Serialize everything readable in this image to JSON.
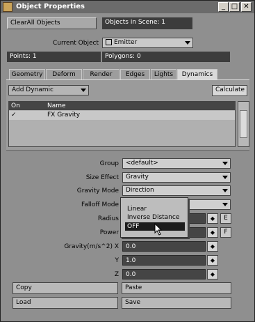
{
  "window": {
    "title": "Object Properties",
    "minimize_glyph": "_",
    "maximize_glyph": "□",
    "close_glyph": "✕"
  },
  "top": {
    "clear_all_label": "ClearAll Objects",
    "objects_in_scene": "Objects in Scene: 1",
    "current_object_label": "Current Object",
    "current_object_value": "Emitter",
    "points": "Points: 1",
    "polygons": "Polygons: 0"
  },
  "tabs": [
    {
      "label": "Geometry",
      "active": false
    },
    {
      "label": "Deform",
      "active": false
    },
    {
      "label": "Render",
      "active": false
    },
    {
      "label": "Edges",
      "active": false
    },
    {
      "label": "Lights",
      "active": false
    },
    {
      "label": "Dynamics",
      "active": true
    }
  ],
  "dynamics": {
    "add_dynamic_label": "Add Dynamic",
    "calculate_label": "Calculate",
    "list_headers": {
      "on": "On",
      "name": "Name"
    },
    "list_rows": [
      {
        "on": "✓",
        "name": "FX Gravity"
      }
    ]
  },
  "form": {
    "group": {
      "label": "Group",
      "value": "<default>"
    },
    "size_effect": {
      "label": "Size Effect",
      "value": "Gravity"
    },
    "gravity_mode": {
      "label": "Gravity Mode",
      "value": "Direction"
    },
    "falloff_mode": {
      "label": "Falloff Mode",
      "value": ""
    },
    "radius": {
      "label": "Radius",
      "env": "E"
    },
    "power": {
      "label": "Power",
      "env": "F"
    },
    "gravity_x": {
      "label": "Gravity(m/s^2) X",
      "value": "0.0"
    },
    "gravity_y": {
      "label": "Y",
      "value": "1.0"
    },
    "gravity_z": {
      "label": "Z",
      "value": "0.0"
    }
  },
  "popup": {
    "options": [
      "Linear",
      "Inverse Distance",
      "OFF"
    ],
    "selected_index": 2
  },
  "buttons": {
    "copy": "Copy",
    "paste": "Paste",
    "load": "Load",
    "save": "Save"
  },
  "colors": {
    "panel": "#8f8f8f",
    "titlebar": "#6b6b6b",
    "dark_field": "#3c3c3c"
  }
}
